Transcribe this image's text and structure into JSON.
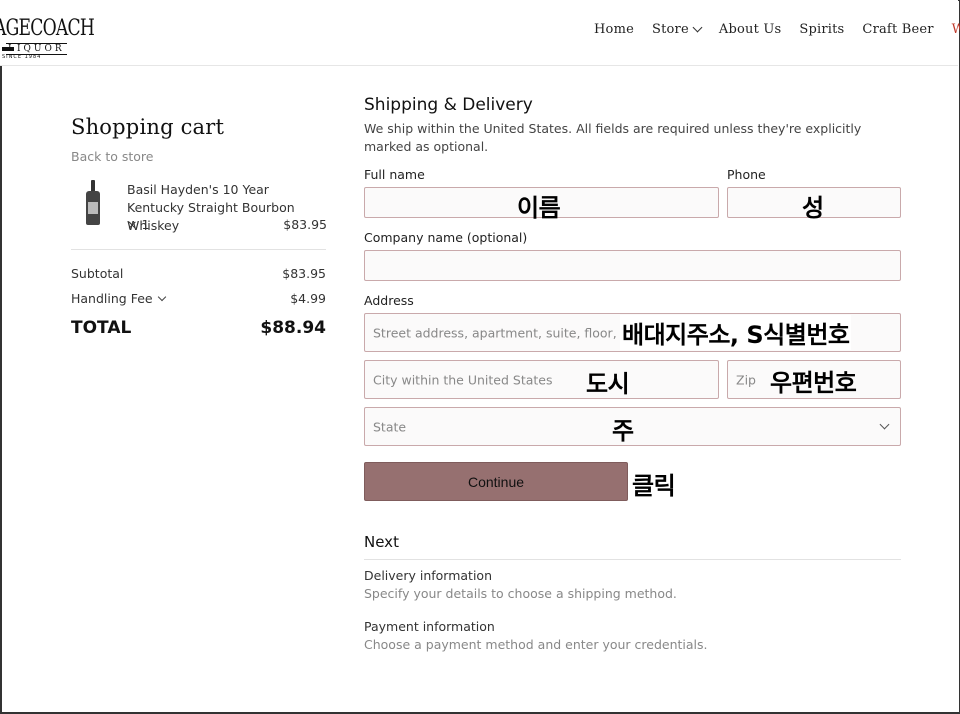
{
  "header": {
    "logo_main": "AGECOACH",
    "logo_sub": "LIQUOR",
    "logo_since": "SINCE 1984",
    "nav": [
      {
        "label": "Home"
      },
      {
        "label": "Store",
        "dropdown": true
      },
      {
        "label": "About Us"
      },
      {
        "label": "Spirits"
      },
      {
        "label": "Craft Beer"
      },
      {
        "label": "Whisk"
      }
    ]
  },
  "cart": {
    "title": "Shopping cart",
    "back_link": "Back to store",
    "item": {
      "name": "Basil Hayden's 10 Year Kentucky Straight Bourbon Whiskey",
      "qty": "× 1",
      "price": "$83.95"
    },
    "subtotal_label": "Subtotal",
    "subtotal_value": "$83.95",
    "handling_label": "Handling Fee",
    "handling_value": "$4.99",
    "total_label": "TOTAL",
    "total_value": "$88.94"
  },
  "shipping": {
    "title": "Shipping & Delivery",
    "description": "We ship within the United States. All fields are required unless they're explicitly marked as optional.",
    "full_name_label": "Full name",
    "phone_label": "Phone",
    "company_label": "Company name (optional)",
    "address_label": "Address",
    "street_placeholder": "Street address, apartment, suite, floor, etc.",
    "city_placeholder": "City within the United States",
    "zip_placeholder": "Zip",
    "state_placeholder": "State",
    "continue_label": "Continue"
  },
  "annotations": {
    "full_name": "이름",
    "phone": "성",
    "street": "배대지주소, S식별번호",
    "city": "도시",
    "zip": "우편번호",
    "state": "주",
    "continue": "클릭"
  },
  "next": {
    "title": "Next",
    "steps": [
      {
        "title": "Delivery information",
        "desc": "Specify your details to choose a shipping method."
      },
      {
        "title": "Payment information",
        "desc": "Choose a payment method and enter your credentials."
      }
    ]
  },
  "colors": {
    "accent_nav": "#c0392b",
    "button": "#967070",
    "input_border": "#c9a9ab"
  }
}
